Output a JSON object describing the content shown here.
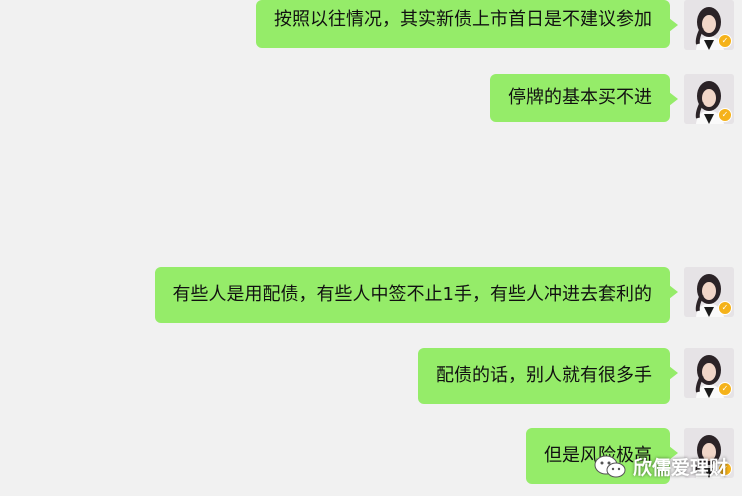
{
  "messages": [
    {
      "text": "按照以往情况，其实新债上市首日是不建议参加"
    },
    {
      "text": "停牌的基本买不进"
    },
    {
      "text": "有些人是用配债，有些人中签不止1手，有些人冲进去套利的"
    },
    {
      "text": "配债的话，别人就有很多手"
    },
    {
      "text": "但是风险极高"
    }
  ],
  "avatar": {
    "badge_icon": "verified-badge-icon"
  },
  "watermark": {
    "text": "欣儒爱理财",
    "icon": "wechat-official-account-icon"
  },
  "colors": {
    "bubble": "#95ec69",
    "background": "#f1f1f1"
  }
}
